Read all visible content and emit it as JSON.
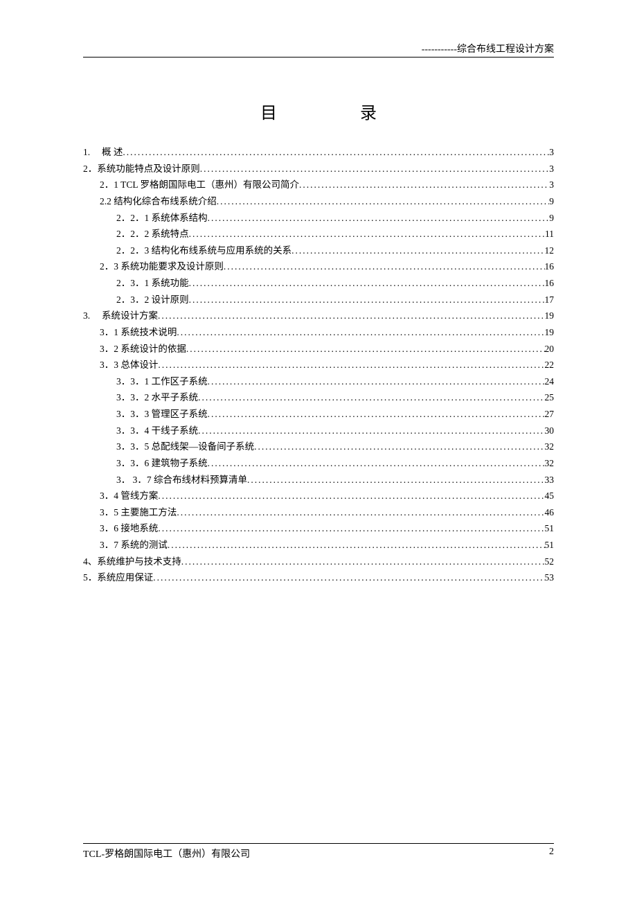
{
  "header": {
    "right_text": "-----------综合布线工程设计方案"
  },
  "title": "目录",
  "toc": [
    {
      "indent": 0,
      "label": "1.　 概 述",
      "page": "3"
    },
    {
      "indent": 0,
      "label": "2．系统功能特点及设计原则",
      "page": "3"
    },
    {
      "indent": 1,
      "label": "2．1  TCL 罗格朗国际电工（惠州）有限公司简介 ",
      "page": "3"
    },
    {
      "indent": 1,
      "label": "2.2 结构化综合布线系统介绍",
      "page": "9"
    },
    {
      "indent": 2,
      "label": "2．2．1 系统体系结构",
      "page": "9"
    },
    {
      "indent": 2,
      "label": "2．2．2 系统特点",
      "page": "11"
    },
    {
      "indent": 2,
      "label": "2．2．3 结构化布线系统与应用系统的关系",
      "page": "12"
    },
    {
      "indent": 1,
      "label": "2．3  系统功能要求及设计原则",
      "page": "16"
    },
    {
      "indent": 2,
      "label": "2．3．1 系统功能",
      "page": "16"
    },
    {
      "indent": 2,
      "label": "2．3．2 设计原则",
      "page": "17"
    },
    {
      "indent": 0,
      "label": "3.　  系统设计方案",
      "page": "19"
    },
    {
      "indent": 1,
      "label": "3．1  系统技术说明",
      "page": "19"
    },
    {
      "indent": 1,
      "label": "3．2  系统设计的依据",
      "page": "20"
    },
    {
      "indent": 1,
      "label": "3．3  总体设计",
      "page": "22"
    },
    {
      "indent": 2,
      "label": "3．3．1 工作区子系统 ",
      "page": "24"
    },
    {
      "indent": 2,
      "label": "3．3．2 水平子系统 ",
      "page": "25"
    },
    {
      "indent": 2,
      "label": "3．3．3 管理区子系统",
      "page": "27"
    },
    {
      "indent": 2,
      "label": "3．3．4 干线子系统",
      "page": "30"
    },
    {
      "indent": 2,
      "label": "3．3．5 总配线架—设备间子系统",
      "page": "32"
    },
    {
      "indent": 2,
      "label": "3．3．6 建筑物子系统 ",
      "page": "32"
    },
    {
      "indent": 2,
      "label": "3． 3．7 综合布线材料预算清单 ",
      "page": "33"
    },
    {
      "indent": 1,
      "label": "3．4 管线方案",
      "page": "45"
    },
    {
      "indent": 1,
      "label": "3．5 主要施工方法",
      "page": "46"
    },
    {
      "indent": 1,
      "label": "3．6 接地系统",
      "page": "51"
    },
    {
      "indent": 1,
      "label": "3．7 系统的测试",
      "page": "51"
    },
    {
      "indent": 0,
      "label": "4、系统维护与技术支持",
      "page": "52"
    },
    {
      "indent": 0,
      "label": "5．系统应用保证",
      "page": "53"
    }
  ],
  "footer": {
    "left": "TCL-罗格朗国际电工（惠州）有限公司",
    "right": "2"
  }
}
